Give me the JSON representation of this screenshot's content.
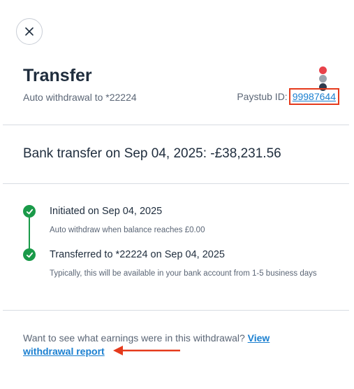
{
  "header": {
    "close_icon": "close-icon",
    "title": "Transfer",
    "subtitle": "Auto withdrawal to *22224",
    "paystub_label": "Paystub ID:",
    "paystub_id": "99987644",
    "status_dots": [
      "#e8424a",
      "#9aa3ad",
      "#2e3b4e"
    ]
  },
  "summary": {
    "text": "Bank transfer on Sep 04, 2025: -£38,231.56"
  },
  "timeline": {
    "steps": [
      {
        "title": "Initiated on Sep 04, 2025",
        "description": "Auto withdraw when balance reaches £0.00",
        "icon": "check-circle-icon"
      },
      {
        "title": "Transferred to *22224 on Sep 04, 2025",
        "description": "Typically, this will be available in your bank account from 1-5 business days",
        "icon": "check-circle-icon"
      }
    ],
    "color": "#1a9a49"
  },
  "footer": {
    "question": "Want to see what earnings were in this withdrawal? ",
    "link_text": "View withdrawal report"
  },
  "colors": {
    "accent": "#1a7fd0",
    "highlight": "#e53a1c",
    "text": "#1f2d3d",
    "muted": "#5b6676"
  }
}
